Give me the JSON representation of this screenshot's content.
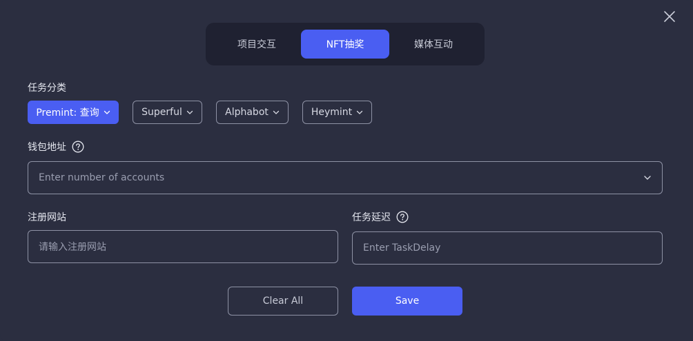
{
  "tabs": [
    {
      "label": "项目交互",
      "active": false
    },
    {
      "label": "NFT抽奖",
      "active": true
    },
    {
      "label": "媒体互动",
      "active": false
    }
  ],
  "category": {
    "label": "任务分类",
    "chips": [
      {
        "label": "Premint: 查询",
        "active": true
      },
      {
        "label": "Superful",
        "active": false
      },
      {
        "label": "Alphabot",
        "active": false
      },
      {
        "label": "Heymint",
        "active": false
      }
    ]
  },
  "wallet": {
    "label": "钱包地址",
    "placeholder": "Enter number of accounts"
  },
  "register": {
    "label": "注册网站",
    "placeholder": "请输入注册网站"
  },
  "delay": {
    "label": "任务延迟",
    "placeholder": "Enter TaskDelay"
  },
  "buttons": {
    "clear": "Clear All",
    "save": "Save"
  },
  "colors": {
    "accent": "#4a5ef2",
    "background": "#2b2e40",
    "tab_bg": "#1f2131"
  },
  "icons": {
    "close": "close-icon",
    "help": "help-circle-icon",
    "dropdown": "chevron-down-icon"
  }
}
